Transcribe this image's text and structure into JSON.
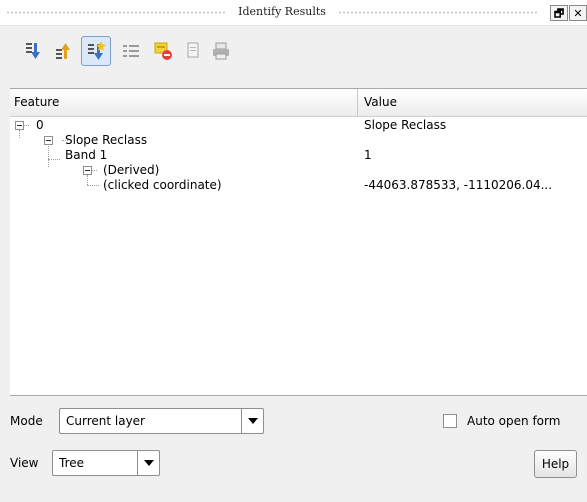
{
  "window": {
    "title": "Identify Results",
    "float_button": "🗗",
    "close_button": "✕"
  },
  "toolbar": {
    "icons": [
      "expand-all-icon",
      "collapse-all-icon",
      "expand-new-results-icon",
      "expand-tree-icon",
      "clear-results-icon",
      "copy-icon",
      "print-icon"
    ]
  },
  "table": {
    "columns": [
      "Feature",
      "Value"
    ],
    "rows": [
      {
        "feature": "0",
        "value": "Slope Reclass"
      },
      {
        "feature": "Slope Reclass",
        "value": ""
      },
      {
        "feature": "Band 1",
        "value": "1"
      },
      {
        "feature": "(Derived)",
        "value": ""
      },
      {
        "feature": "(clicked coordinate)",
        "value": "-44063.878533, -1110206.04..."
      }
    ]
  },
  "controls": {
    "mode_label": "Mode",
    "mode_value": "Current layer",
    "auto_open_label": "Auto open form",
    "auto_open_checked": false,
    "view_label": "View",
    "view_value": "Tree",
    "help_label": "Help"
  }
}
